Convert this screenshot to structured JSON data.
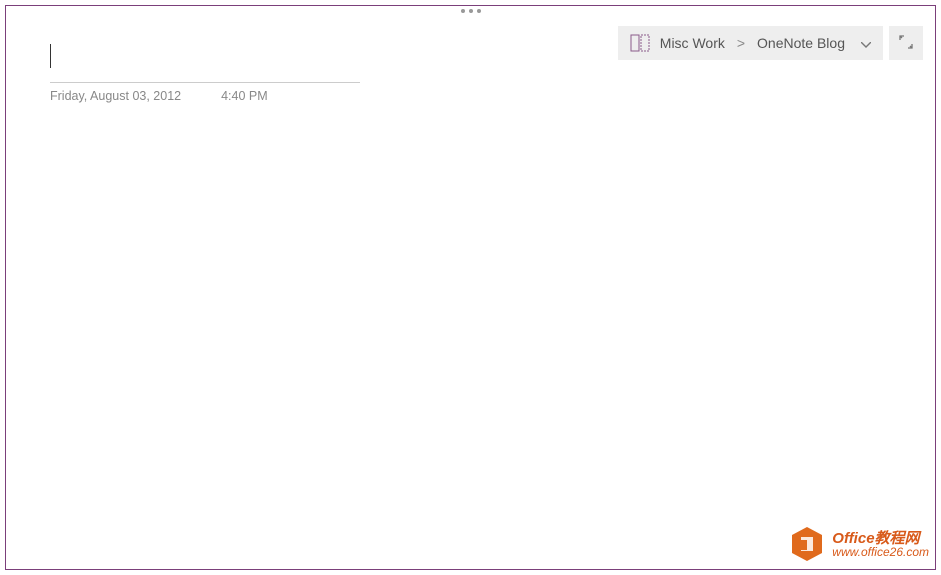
{
  "handle": {
    "dots": 3
  },
  "breadcrumb": {
    "notebook": "Misc Work",
    "separator": ">",
    "section": "OneNote Blog"
  },
  "note": {
    "title_value": "",
    "date": "Friday, August 03, 2012",
    "time": "4:40 PM"
  },
  "watermark": {
    "line1": "Office教程网",
    "line2": "www.office26.com"
  }
}
